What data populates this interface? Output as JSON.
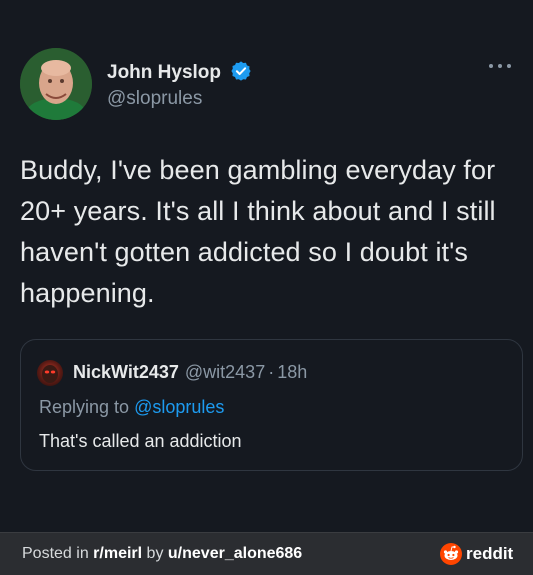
{
  "tweet": {
    "author_name": "John Hyslop",
    "author_handle": "@sloprules",
    "text": "Buddy, I've been gambling everyday for 20+ years. It's all I think about and I still haven't gotten addicted so I doubt it's happening."
  },
  "quote": {
    "name": "NickWit2437",
    "handle": "@wit2437",
    "separator": "·",
    "time": "18h",
    "replying_prefix": "Replying to",
    "replying_handle": "@sloprules",
    "body": "That's called an addiction"
  },
  "footer": {
    "posted_in_prefix": "Posted in",
    "subreddit": "r/meirl",
    "by": "by",
    "user": "u/never_alone686",
    "brand": "reddit"
  },
  "colors": {
    "background": "#151920",
    "verified": "#1d9bf0",
    "link": "#1d9bf0",
    "reddit_orange": "#ff4500"
  },
  "icons": {
    "avatar": "avatar-photo",
    "verified": "verified-badge-icon",
    "more": "more-options-icon",
    "reddit": "reddit-logo-icon"
  }
}
